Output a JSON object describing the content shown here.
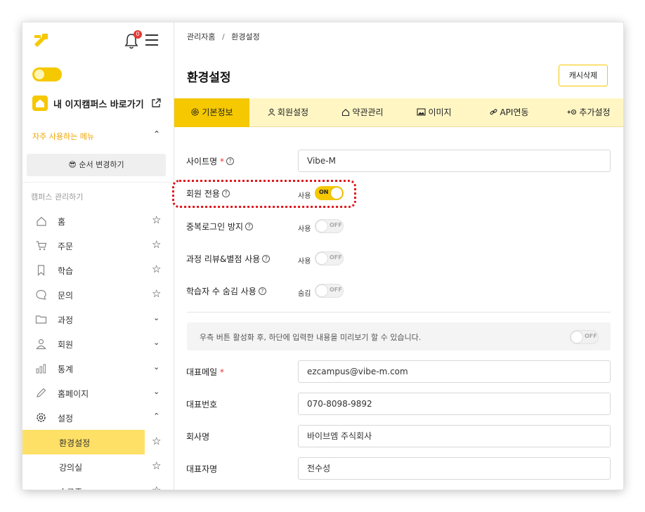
{
  "sidebar": {
    "notification_count": "0",
    "shortcut_label": "내 이지캠퍼스 바로가기",
    "favorites_title": "자주 사용하는 메뉴",
    "reorder_label": "😎 순서 변경하기",
    "campus_section_title": "캠퍼스 관리하기",
    "items": [
      {
        "label": "홈",
        "icon": "home-icon",
        "action": "star"
      },
      {
        "label": "주문",
        "icon": "cart-icon",
        "action": "star"
      },
      {
        "label": "학습",
        "icon": "bookmark-icon",
        "action": "star"
      },
      {
        "label": "문의",
        "icon": "chat-icon",
        "action": "star"
      },
      {
        "label": "과정",
        "icon": "folder-icon",
        "action": "chevron"
      },
      {
        "label": "회원",
        "icon": "user-icon",
        "action": "chevron"
      },
      {
        "label": "통계",
        "icon": "chart-icon",
        "action": "chevron"
      },
      {
        "label": "홈페이지",
        "icon": "pencil-icon",
        "action": "chevron"
      },
      {
        "label": "설정",
        "icon": "gear-icon",
        "action": "chevron-up"
      },
      {
        "label": "환경설정",
        "active": true,
        "action": "star"
      },
      {
        "label": "강의실",
        "action": "star"
      },
      {
        "label": "수료증",
        "action": "star"
      }
    ]
  },
  "breadcrumb": {
    "home": "관리자홈",
    "separator": "/",
    "current": "환경설정"
  },
  "page": {
    "title": "환경설정",
    "cache_button": "캐시삭제"
  },
  "tabs": [
    {
      "label": "기본정보",
      "icon": "gear-icon",
      "active": true
    },
    {
      "label": "회원설정",
      "icon": "user-icon"
    },
    {
      "label": "약관관리",
      "icon": "home-icon"
    },
    {
      "label": "이미지",
      "icon": "image-icon"
    },
    {
      "label": "API연동",
      "icon": "link-icon"
    },
    {
      "label": "추가설정",
      "icon": "plus-settings-icon"
    }
  ],
  "form": {
    "site_name": {
      "label": "사이트명",
      "required": "*",
      "value": "Vibe-M"
    },
    "member_only": {
      "label": "회원 전용",
      "state_label": "사용",
      "toggle": "ON"
    },
    "duplicate_login": {
      "label": "중복로그인 방지",
      "state_label": "사용",
      "toggle": "OFF"
    },
    "course_review": {
      "label": "과정 리뷰&별점 사용",
      "state_label": "사용",
      "toggle": "OFF"
    },
    "hide_learner_count": {
      "label": "학습자 수 숨김 사용",
      "state_label": "숨김",
      "toggle": "OFF"
    },
    "preview_note": {
      "text": "우측 버튼 활성화 후, 하단에 입력한 내용을 미리보기 할 수 있습니다.",
      "toggle": "OFF"
    },
    "email": {
      "label": "대표메일",
      "required": "*",
      "value": "ezcampus@vibe-m.com"
    },
    "phone": {
      "label": "대표번호",
      "value": "070-8098-9892"
    },
    "company": {
      "label": "회사명",
      "value": "바이브엠 주식회사"
    },
    "ceo": {
      "label": "대표자명",
      "value": "전수성"
    }
  },
  "colors": {
    "accent": "#f5c800",
    "tab_bar": "#fff6c4",
    "highlight": "#e0161b"
  }
}
